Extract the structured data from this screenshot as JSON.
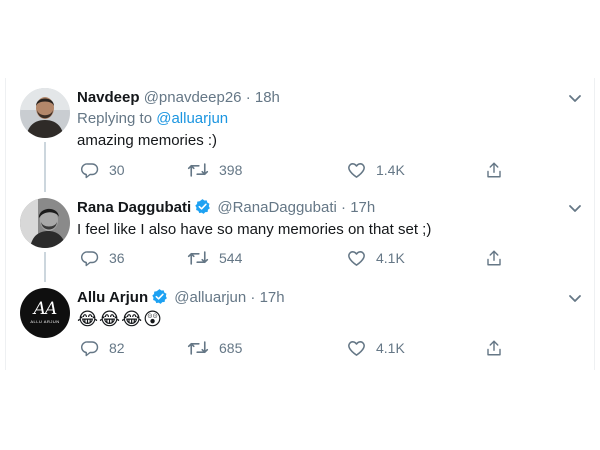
{
  "tweets": [
    {
      "name": "Navdeep",
      "handle": "@pnavdeep26",
      "separator": "·",
      "time": "18h",
      "verified": false,
      "reply_prefix": "Replying to",
      "reply_mention": "@alluarjun",
      "text": "amazing memories :)",
      "replies": "30",
      "retweets": "398",
      "likes": "1.4K",
      "avatar_icon": "photo-avatar"
    },
    {
      "name": "Rana Daggubati",
      "handle": "@RanaDaggubati",
      "separator": "·",
      "time": "17h",
      "verified": true,
      "text": "I feel like I also have so many memories on that set ;)",
      "replies": "36",
      "retweets": "544",
      "likes": "4.1K",
      "avatar_icon": "photo-avatar-bw"
    },
    {
      "name": "Allu Arjun",
      "handle": "@alluarjun",
      "separator": "·",
      "time": "17h",
      "verified": true,
      "text": "😂😂😂😲",
      "replies": "82",
      "retweets": "685",
      "likes": "4.1K",
      "avatar_logo": {
        "mark": "AA",
        "caption": "ALLU ARJUN"
      }
    }
  ],
  "colors": {
    "accent": "#1b95e0",
    "verified": "#1da1f2",
    "muted": "#657786",
    "text": "#14171a",
    "thread_line": "#ccd6dd"
  },
  "icons": {
    "reply": "reply-icon",
    "retweet": "retweet-icon",
    "like": "heart-icon",
    "share": "share-icon",
    "more": "chevron-down-icon",
    "verified": "verified-badge-icon"
  }
}
